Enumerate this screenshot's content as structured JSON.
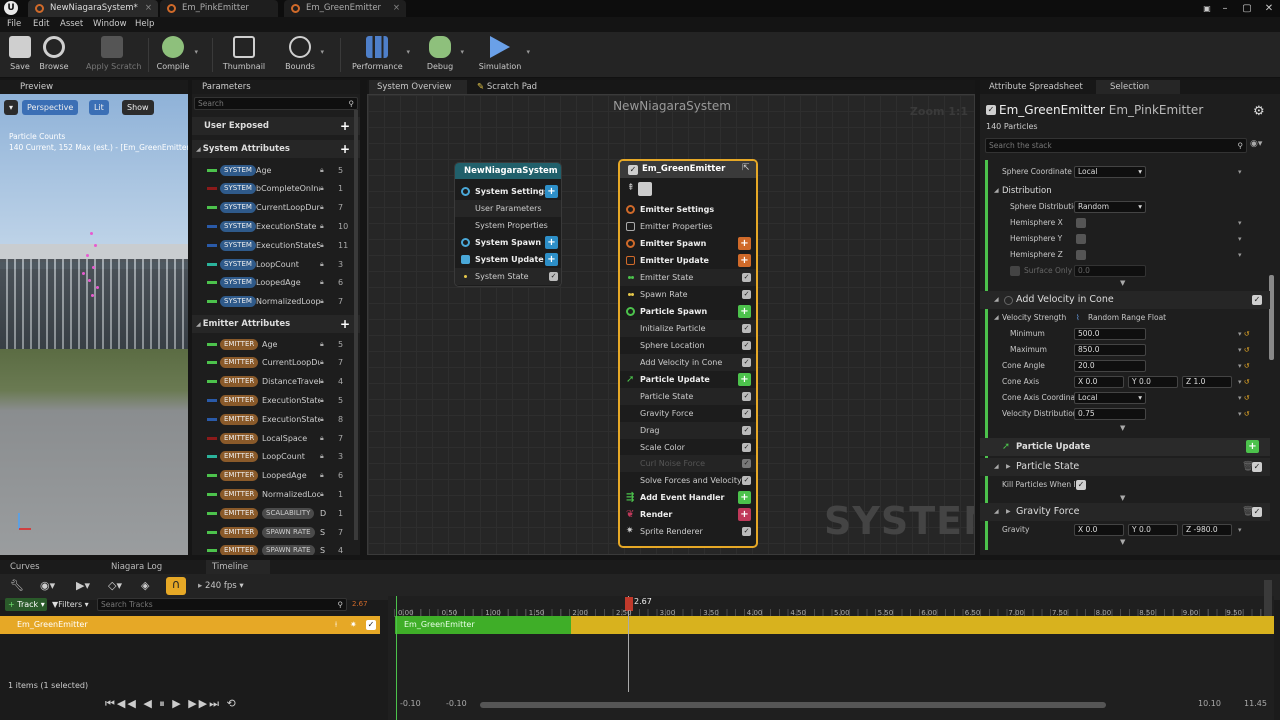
{
  "tabs": [
    {
      "label": "NewNiagaraSystem*"
    },
    {
      "label": "Em_PinkEmitter"
    },
    {
      "label": "Em_GreenEmitter"
    }
  ],
  "menu": [
    "File",
    "Edit",
    "Asset",
    "Window",
    "Help"
  ],
  "toolbar": {
    "save": "Save",
    "browse": "Browse",
    "apply": "Apply Scratch",
    "compile": "Compile",
    "thumbnail": "Thumbnail",
    "bounds": "Bounds",
    "performance": "Performance",
    "debug": "Debug",
    "simulation": "Simulation"
  },
  "preview": {
    "tab": "Preview",
    "perspective": "Perspective",
    "lit": "Lit",
    "show": "Show",
    "counts_title": "Particle Counts",
    "counts": "140 Current, 152 Max (est.) - [Em_GreenEmitter]"
  },
  "params": {
    "tab": "Parameters",
    "search": "Search",
    "user_exposed": "User Exposed",
    "system_attributes": "System Attributes",
    "emitter_attributes": "Emitter Attributes",
    "system_rows": [
      {
        "tag": "SYSTEM",
        "name": "Age",
        "count": "5",
        "color": "#4cc24c"
      },
      {
        "tag": "SYSTEM",
        "name": "bCompleteOnInac",
        "count": "1",
        "color": "#8b1a1a"
      },
      {
        "tag": "SYSTEM",
        "name": "CurrentLoopDura",
        "count": "7",
        "color": "#4cc24c"
      },
      {
        "tag": "SYSTEM",
        "name": "ExecutionState",
        "count": "10",
        "color": "#2a5aa8"
      },
      {
        "tag": "SYSTEM",
        "name": "ExecutionStateS",
        "count": "11",
        "color": "#2a5aa8"
      },
      {
        "tag": "SYSTEM",
        "name": "LoopCount",
        "count": "3",
        "color": "#2bb39b"
      },
      {
        "tag": "SYSTEM",
        "name": "LoopedAge",
        "count": "6",
        "color": "#4cc24c"
      },
      {
        "tag": "SYSTEM",
        "name": "NormalizedLoopA",
        "count": "7",
        "color": "#4cc24c"
      }
    ],
    "emitter_rows": [
      {
        "tag": "EMITTER",
        "name": "Age",
        "count": "5",
        "color": "#4cc24c"
      },
      {
        "tag": "EMITTER",
        "name": "CurrentLoopDura",
        "count": "7",
        "color": "#4cc24c"
      },
      {
        "tag": "EMITTER",
        "name": "DistanceTraveled",
        "count": "4",
        "color": "#4cc24c"
      },
      {
        "tag": "EMITTER",
        "name": "ExecutionState",
        "count": "5",
        "color": "#2a5aa8"
      },
      {
        "tag": "EMITTER",
        "name": "ExecutionStateSo",
        "count": "8",
        "color": "#2a5aa8"
      },
      {
        "tag": "EMITTER",
        "name": "LocalSpace",
        "count": "7",
        "color": "#8b1a1a"
      },
      {
        "tag": "EMITTER",
        "name": "LoopCount",
        "count": "3",
        "color": "#2bb39b"
      },
      {
        "tag": "EMITTER",
        "name": "LoopedAge",
        "count": "6",
        "color": "#4cc24c"
      },
      {
        "tag": "EMITTER",
        "name": "NormalizedLoopA",
        "count": "1",
        "color": "#4cc24c"
      },
      {
        "tag": "EMITTER",
        "name": "SCALABILITY",
        "count": "1",
        "color": "#4cc24c",
        "extra": "D"
      },
      {
        "tag": "EMITTER",
        "name": "SPAWN RATE",
        "count": "7",
        "color": "#4cc24c",
        "extra": "S"
      },
      {
        "tag": "EMITTER",
        "name": "SPAWN RATE",
        "count": "4",
        "color": "#4cc24c",
        "extra": "S"
      }
    ]
  },
  "graph": {
    "tab_overview": "System Overview",
    "tab_scratch": "Scratch Pad",
    "title": "NewNiagaraSystem",
    "zoom": "Zoom 1:1",
    "watermark": "SYSTEM",
    "system_node": {
      "title": "NewNiagaraSystem",
      "rows": [
        "System Settings",
        "User Parameters",
        "System Properties",
        "System Spawn",
        "System Update",
        "System State"
      ]
    },
    "emitter_node": {
      "title": "Em_GreenEmitter",
      "rows": [
        "Emitter Settings",
        "Emitter Properties",
        "Emitter Spawn",
        "Emitter Update",
        "Emitter State",
        "Spawn Rate",
        "Particle Spawn",
        "Initialize Particle",
        "Sphere Location",
        "Add Velocity in Cone",
        "Particle Update",
        "Particle State",
        "Gravity Force",
        "Drag",
        "Scale Color",
        "Curl Noise Force",
        "Solve Forces and Velocity",
        "Add Event Handler",
        "Render",
        "Sprite Renderer"
      ]
    }
  },
  "right": {
    "tab_spreadsheet": "Attribute Spreadsheet",
    "tab_selection": "Selection",
    "emitter1": "Em_GreenEmitter",
    "emitter2": "Em_PinkEmitter",
    "particles": "140 Particles",
    "search": "Search the stack",
    "sphere_coord_label": "Sphere Coordinate S",
    "sphere_coord_val": "Local",
    "distribution": "Distribution",
    "sphere_dist_label": "Sphere Distributio",
    "sphere_dist_val": "Random",
    "hemi_x": "Hemisphere X",
    "hemi_y": "Hemisphere Y",
    "hemi_z": "Hemisphere Z",
    "surface_only": "Surface Only",
    "surface_only_val": "0.0",
    "add_velocity": "Add Velocity in Cone",
    "velocity_strength": "Velocity Strength",
    "random_range": "Random Range Float",
    "minimum": "Minimum",
    "minimum_val": "500.0",
    "maximum": "Maximum",
    "maximum_val": "850.0",
    "cone_angle": "Cone Angle",
    "cone_angle_val": "20.0",
    "cone_axis": "Cone Axis",
    "cone_x": "X 0.0",
    "cone_y": "Y 0.0",
    "cone_z": "Z 1.0",
    "cone_axis_coord": "Cone Axis Coordinat",
    "cone_axis_coord_val": "Local",
    "velocity_dist": "Velocity Distributior",
    "velocity_dist_val": "0.75",
    "particle_update": "Particle Update",
    "particle_state": "Particle State",
    "kill_particles": "Kill Particles When I",
    "gravity_force": "Gravity Force",
    "gravity": "Gravity",
    "grav_x": "X 0.0",
    "grav_y": "Y 0.0",
    "grav_z": "Z -980.0"
  },
  "bottom": {
    "tab_curves": "Curves",
    "tab_log": "Niagara Log",
    "tab_timeline": "Timeline",
    "fps": "240 fps",
    "track": "Track",
    "filters": "Filters",
    "search": "Search Tracks",
    "track_name": "Em_GreenEmitter",
    "bar_label": "Em_GreenEmitter",
    "time": "2.67",
    "time_small": "2.67",
    "selected": "1 items (1 selected)",
    "range_a": "-0.10",
    "range_b": "-0.10",
    "range_c": "10.10",
    "range_d": "11.45",
    "ticks": [
      "0.00",
      "0.50",
      "1.00",
      "1.50",
      "2.00",
      "2.50",
      "3.00",
      "3.50",
      "4.00",
      "4.50",
      "5.00",
      "5.50",
      "6.00",
      "6.50",
      "7.00",
      "7.50",
      "8.00",
      "8.50",
      "9.00",
      "9.50"
    ]
  }
}
